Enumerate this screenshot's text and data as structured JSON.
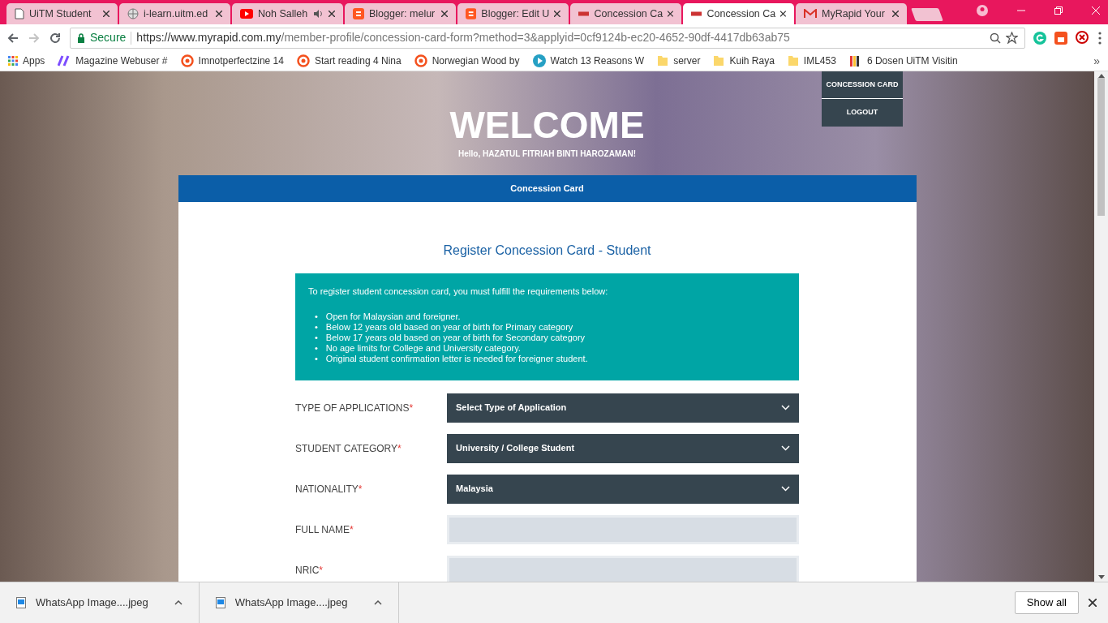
{
  "browser": {
    "tabs": [
      {
        "title": "UiTM Student",
        "audio": false,
        "selected": false
      },
      {
        "title": "i-learn.uitm.ed",
        "audio": false,
        "selected": false
      },
      {
        "title": "Noh Salleh",
        "audio": true,
        "selected": false
      },
      {
        "title": "Blogger: melur",
        "audio": false,
        "selected": false
      },
      {
        "title": "Blogger: Edit U",
        "audio": false,
        "selected": false
      },
      {
        "title": "Concession Ca",
        "audio": false,
        "selected": false
      },
      {
        "title": "Concession Ca",
        "audio": false,
        "selected": true
      },
      {
        "title": "MyRapid Your",
        "audio": false,
        "selected": false
      }
    ],
    "address": {
      "secure": "Secure",
      "host": "https://www.myrapid.com.my",
      "path": "/member-profile/concession-card-form?method=3&applyid=0cf9124b-ec20-4652-90df-4417db63ab75"
    },
    "bookmarks": [
      "Apps",
      "Magazine Webuser #",
      "Imnotperfectzine 14",
      "Start reading 4 Nina",
      "Norwegian Wood by",
      "Watch 13 Reasons W",
      "server",
      "Kuih Raya",
      "IML453",
      "6 Dosen UiTM Visitin"
    ],
    "bookmarks_more": "»"
  },
  "page": {
    "nav": [
      "CONCESSION CARD",
      "LOGOUT"
    ],
    "welcome": {
      "title": "WELCOME",
      "greeting": "Hello, HAZATUL FITRIAH BINTI HAROZAMAN!"
    },
    "section_tab": "Concession Card",
    "form_title": "Register Concession Card - Student",
    "info": {
      "intro": "To register student concession card, you must fulfill the requirements below:",
      "bullet": "•",
      "items": [
        "Open for Malaysian and foreigner.",
        "Below 12 years old based on year of birth for Primary category",
        "Below 17 years old based on year of birth for Secondary category",
        "No age limits for College and University category.",
        "Original student confirmation letter is needed for foreigner student."
      ]
    },
    "fields": [
      {
        "label": "TYPE OF APPLICATIONS",
        "required_mark": "*",
        "kind": "select",
        "value": "Select Type of Application"
      },
      {
        "label": "STUDENT CATEGORY",
        "required_mark": "*",
        "kind": "select",
        "value": "University / College Student"
      },
      {
        "label": "NATIONALITY",
        "required_mark": "*",
        "kind": "select",
        "value": "Malaysia"
      },
      {
        "label": "FULL NAME",
        "required_mark": "*",
        "kind": "text"
      },
      {
        "label": "NRIC",
        "required_mark": "*",
        "kind": "text"
      }
    ]
  },
  "downloads": {
    "files": [
      "WhatsApp Image....jpeg",
      "WhatsApp Image....jpeg"
    ],
    "show_all": "Show all"
  }
}
